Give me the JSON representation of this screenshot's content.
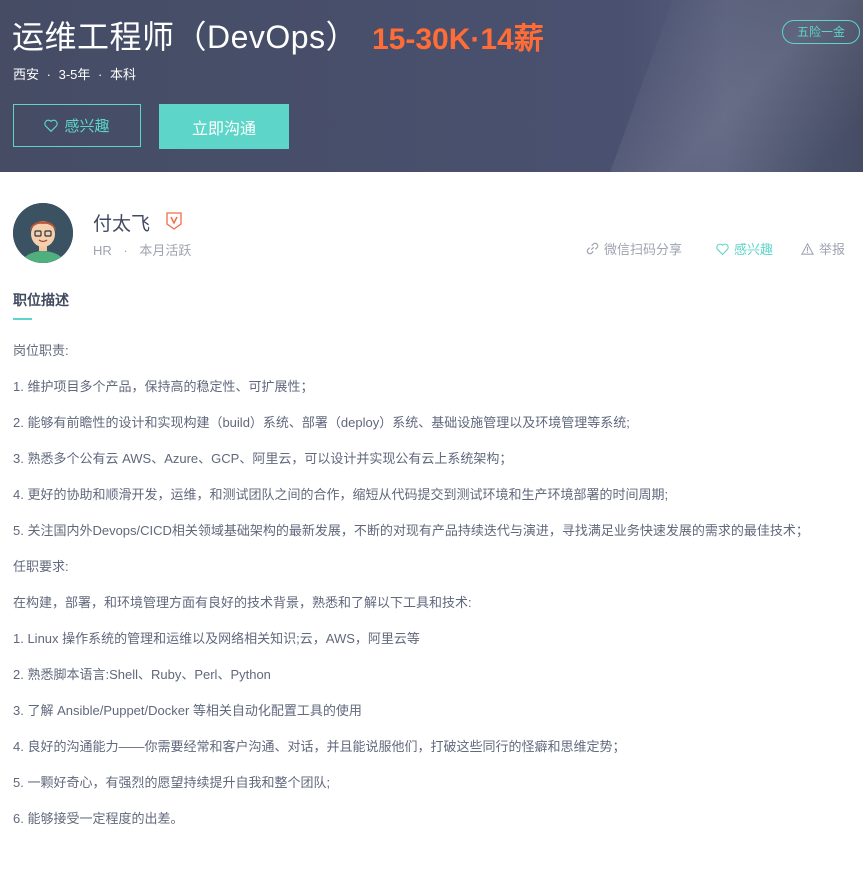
{
  "header": {
    "job_title": "运维工程师（DevOps）",
    "salary": "15-30K·14薪",
    "benefit_tag": "五险一金",
    "location": "西安",
    "experience": "3-5年",
    "education": "本科",
    "dot": "·",
    "interest_button": "感兴趣",
    "chat_button": "立即沟通"
  },
  "recruiter": {
    "name": "付太飞",
    "role": "HR",
    "sep": "·",
    "activity": "本月活跃"
  },
  "actions": {
    "share": "微信扫码分享",
    "interest": "感兴趣",
    "report": "举报"
  },
  "section": {
    "title": "职位描述"
  },
  "description": [
    "岗位职责:",
    "1. 维护项目多个产品，保持高的稳定性、可扩展性；",
    "2. 能够有前瞻性的设计和实现构建（build）系统、部署（deploy）系统、基础设施管理以及环境管理等系统;",
    "3. 熟悉多个公有云 AWS、Azure、GCP、阿里云，可以设计并实现公有云上系统架构；",
    "4. 更好的协助和顺滑开发，运维，和测试团队之间的合作，缩短从代码提交到测试环境和生产环境部署的时间周期;",
    "5. 关注国内外Devops/CICD相关领域基础架构的最新发展，不断的对现有产品持续迭代与演进，寻找满足业务快速发展的需求的最佳技术；",
    "任职要求:",
    "在构建，部署，和环境管理方面有良好的技术背景，熟悉和了解以下工具和技术:",
    "1. Linux 操作系统的管理和运维以及网络相关知识;云，AWS，阿里云等",
    "2. 熟悉脚本语言:Shell、Ruby、Perl、Python",
    "3. 了解 Ansible/Puppet/Docker 等相关自动化配置工具的使用",
    "4. 良好的沟通能力——你需要经常和客户沟通、对话，并且能说服他们，打破这些同行的怪癖和思维定势；",
    "5. 一颗好奇心，有强烈的愿望持续提升自我和整个团队;",
    "6. 能够接受一定程度的出差。"
  ],
  "colors": {
    "accent": "#5dd5c8",
    "salary": "#ff6c36",
    "header_bg": "#454c64",
    "text": "#414a60",
    "muted": "#9fa3b0"
  },
  "icons": {
    "interest": "heart-icon",
    "share": "link-icon",
    "report": "warning-icon",
    "verify": "verified-badge-icon"
  }
}
